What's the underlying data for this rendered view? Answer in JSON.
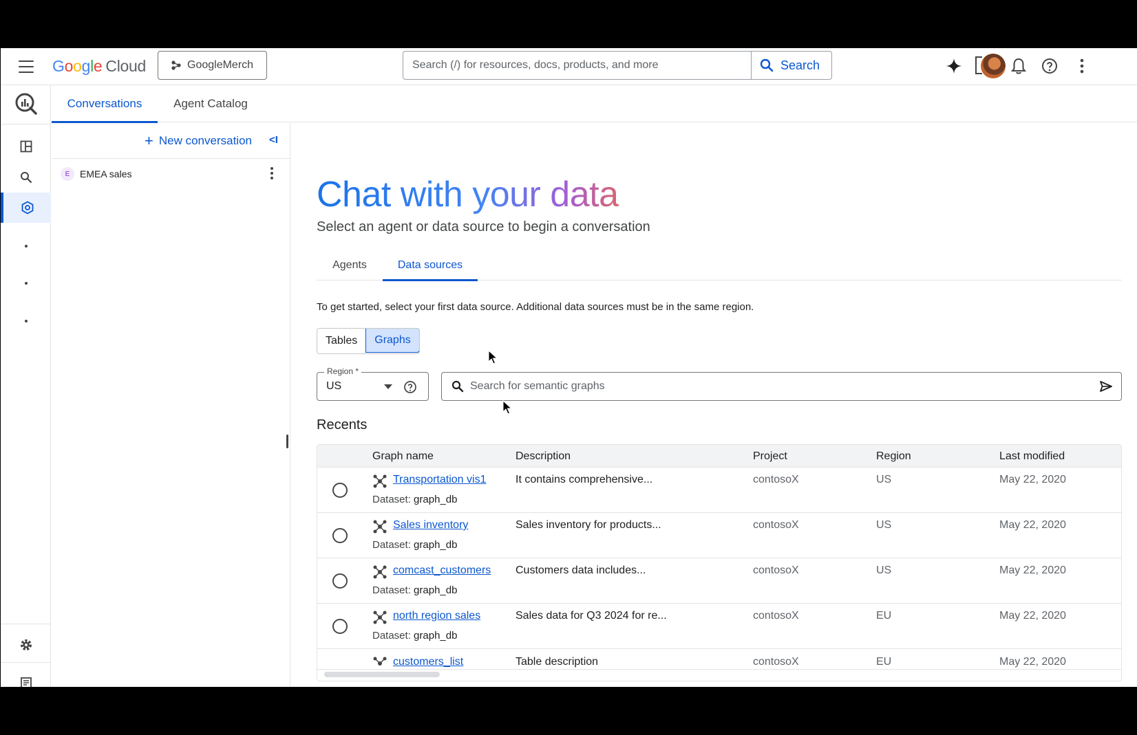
{
  "topbar": {
    "logo_google": [
      "G",
      "o",
      "o",
      "g",
      "l",
      "e"
    ],
    "logo_cloud": "Cloud",
    "project": "GoogleMerch",
    "search_placeholder": "Search (/) for resources, docs, products, and more",
    "search_button": "Search"
  },
  "tabs": [
    {
      "label": "Conversations",
      "active": true
    },
    {
      "label": "Agent Catalog",
      "active": false
    }
  ],
  "conversations": {
    "new_label": "New conversation",
    "collapse_glyph": "<I",
    "items": [
      {
        "badge": "E",
        "label": "EMEA sales"
      }
    ]
  },
  "main": {
    "title": "Chat with your data",
    "subtitle": "Select an agent or data source to begin a conversation",
    "inner_tabs": [
      {
        "label": "Agents",
        "active": false
      },
      {
        "label": "Data sources",
        "active": true
      }
    ],
    "instructions": "To get started, select your first data source. Additional data sources must be in the same region.",
    "segments": [
      {
        "label": "Tables",
        "active": false
      },
      {
        "label": "Graphs",
        "active": true
      }
    ],
    "region": {
      "label": "Region *",
      "value": "US"
    },
    "graph_search_placeholder": "Search for semantic graphs",
    "recents_title": "Recents"
  },
  "table": {
    "columns": [
      "Graph name",
      "Description",
      "Project",
      "Region",
      "Last modified"
    ],
    "dataset_label": "Dataset:",
    "rows": [
      {
        "name": "Transportation vis1",
        "dataset": "graph_db",
        "description": "It contains comprehensive...",
        "project": "contosoX",
        "region": "US",
        "modified": "May 22, 2020"
      },
      {
        "name": "Sales inventory",
        "dataset": "graph_db",
        "description": "Sales inventory for products...",
        "project": "contosoX",
        "region": "US",
        "modified": "May 22, 2020"
      },
      {
        "name": "comcast_customers",
        "dataset": "graph_db",
        "description": "Customers data includes...",
        "project": "contosoX",
        "region": "US",
        "modified": "May 22, 2020"
      },
      {
        "name": "north region sales",
        "dataset": "graph_db",
        "description": "Sales data for Q3 2024 for re...",
        "project": "contosoX",
        "region": "EU",
        "modified": "May 22, 2020"
      },
      {
        "name": "customers_list",
        "dataset": "",
        "description": "Table description",
        "project": "contosoX",
        "region": "EU",
        "modified": "May 22, 2020"
      }
    ]
  },
  "colors": {
    "accent": "#0b57d0",
    "border": "#e3e3e3",
    "active_bg": "#d3e3fd"
  }
}
